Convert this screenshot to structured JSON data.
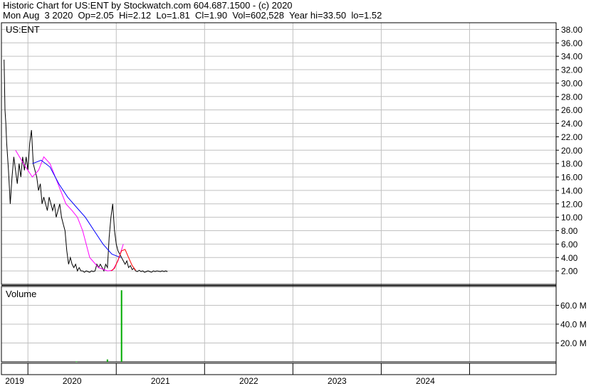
{
  "header": {
    "line1": "Historic Chart for US:ENT by Stockwatch.com 604.687.1500 - (c) 2020",
    "line2": "Mon Aug  3 2020  Op=2.05  Hi=2.12  Lo=1.81  Cl=1.90  Vol=602,528  Year hi=33.50  lo=1.52"
  },
  "colors": {
    "price": "#000000",
    "ma_short": "#ff00ff",
    "ma_long": "#0000ff",
    "ma_recent": "#ff0000",
    "volume": "#00aa00",
    "grid": "#c0c0c0"
  },
  "chart_data": [
    {
      "type": "line",
      "title": "US:ENT",
      "ylim": [
        0,
        39
      ],
      "y_ticks": [
        "38.00",
        "36.00",
        "34.00",
        "32.00",
        "30.00",
        "28.00",
        "26.00",
        "24.00",
        "22.00",
        "20.00",
        "18.00",
        "16.00",
        "14.00",
        "12.00",
        "10.00",
        "8.00",
        "6.00",
        "4.00",
        "2.00"
      ],
      "grid": true,
      "series": [
        {
          "role": "price",
          "x": [
            2018.73,
            2018.74,
            2018.75,
            2018.76,
            2018.78,
            2018.8,
            2018.82,
            2018.84,
            2018.86,
            2018.88,
            2018.9,
            2018.92,
            2018.94,
            2018.96,
            2018.98,
            2019.0,
            2019.02,
            2019.04,
            2019.06,
            2019.08,
            2019.1,
            2019.12,
            2019.14,
            2019.16,
            2019.18,
            2019.2,
            2019.22,
            2019.24,
            2019.26,
            2019.28,
            2019.3,
            2019.32,
            2019.34,
            2019.36,
            2019.38,
            2019.4,
            2019.42,
            2019.44,
            2019.46,
            2019.48,
            2019.5,
            2019.52,
            2019.54,
            2019.56,
            2019.58,
            2019.6,
            2019.62,
            2019.64,
            2019.66,
            2019.68,
            2019.7,
            2019.72,
            2019.74,
            2019.76,
            2019.78,
            2019.8,
            2019.82,
            2019.84,
            2019.86,
            2019.88,
            2019.9,
            2019.92,
            2019.94,
            2019.96,
            2019.98,
            2020.0,
            2020.02,
            2020.04,
            2020.06,
            2020.08,
            2020.1,
            2020.12,
            2020.14,
            2020.16,
            2020.18,
            2020.2,
            2020.22,
            2020.24,
            2020.26,
            2020.28,
            2020.3,
            2020.32,
            2020.34,
            2020.36,
            2020.38,
            2020.4,
            2020.42,
            2020.44,
            2020.46,
            2020.48,
            2020.5,
            2020.52,
            2020.54,
            2020.56,
            2020.58
          ],
          "values": [
            33.5,
            26,
            24,
            21,
            17,
            12,
            16,
            19,
            17,
            15,
            18,
            16,
            19,
            17,
            19,
            17,
            21,
            23,
            18,
            17,
            16,
            14,
            15,
            12,
            13,
            12,
            11,
            13,
            12,
            11,
            12,
            10,
            11,
            12,
            10,
            9,
            8,
            5,
            3,
            4,
            3,
            2.5,
            3,
            2,
            2.5,
            2,
            2,
            1.8,
            2,
            1.9,
            1.8,
            2,
            1.9,
            2,
            3,
            2.5,
            3,
            2.5,
            2,
            3,
            2.5,
            7,
            10,
            12,
            8,
            6,
            5,
            4.5,
            4,
            3.5,
            3,
            3.5,
            2.5,
            2.8,
            2.2,
            2.4,
            2,
            1.9,
            2.1,
            1.9,
            2,
            1.8,
            1.9,
            2,
            1.9,
            1.8,
            2,
            1.9,
            2,
            1.95,
            1.9,
            2,
            1.9,
            2,
            1.9
          ]
        },
        {
          "role": "ma_short",
          "x": [
            2018.86,
            2018.95,
            2019.05,
            2019.12,
            2019.18,
            2019.25,
            2019.31,
            2019.37,
            2019.43,
            2019.5,
            2019.56,
            2019.62,
            2019.7,
            2019.8,
            2019.9,
            2019.96,
            2020.02,
            2020.08
          ],
          "values": [
            20,
            18,
            16,
            17,
            19,
            18,
            16,
            14,
            12,
            11,
            10,
            8,
            4,
            2.5,
            2,
            2.1,
            3.5,
            6
          ]
        },
        {
          "role": "ma_long",
          "x": [
            2019.05,
            2019.15,
            2019.25,
            2019.35,
            2019.45,
            2019.55,
            2019.65,
            2019.75,
            2019.85,
            2019.95,
            2020.05
          ],
          "values": [
            18,
            18.5,
            17.5,
            15,
            13,
            11.5,
            10,
            8,
            6,
            4.5,
            4
          ]
        },
        {
          "role": "ma_recent",
          "x": [
            2019.94,
            2019.98,
            2020.02,
            2020.06,
            2020.1,
            2020.14,
            2020.18,
            2020.22
          ],
          "values": [
            2,
            2.4,
            3.6,
            5,
            5.2,
            4,
            2.8,
            2.1
          ]
        }
      ]
    },
    {
      "type": "bar",
      "title": "Volume",
      "ylim": [
        0,
        80
      ],
      "y_ticks": [
        "60.0 M",
        "40.0 M",
        "20.0 M"
      ],
      "x": [
        2019.55,
        2019.9,
        2020.06
      ],
      "values": [
        0.5,
        2.5,
        76
      ]
    }
  ],
  "x_axis": {
    "labels": [
      "2019",
      "2020",
      "2021",
      "2022",
      "2023",
      "2024"
    ]
  }
}
